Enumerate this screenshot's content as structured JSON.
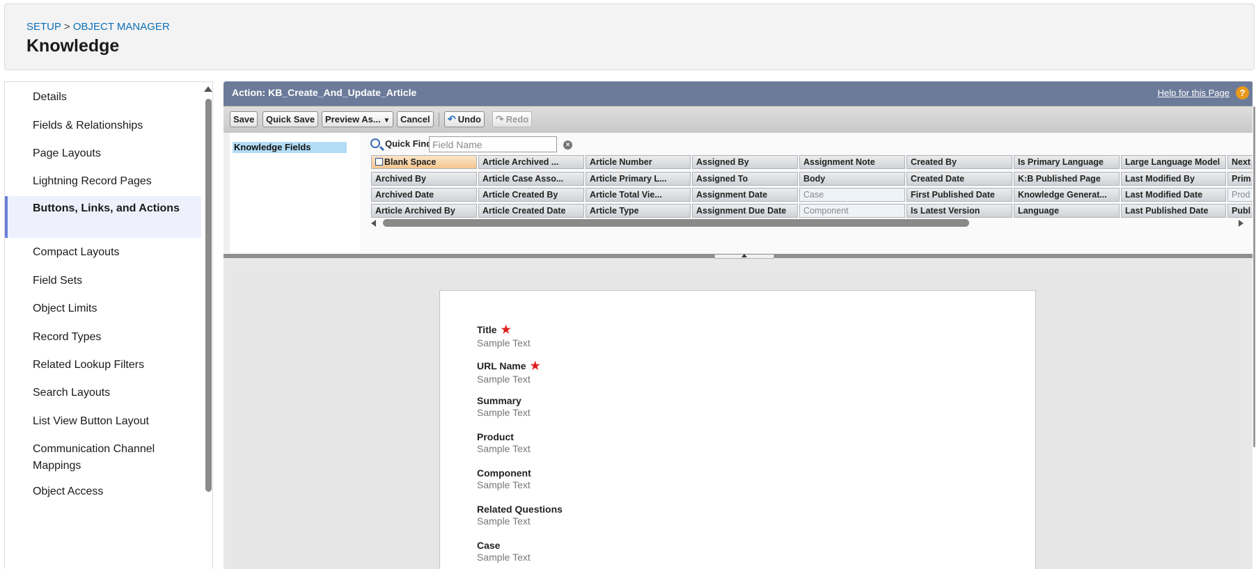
{
  "header": {
    "breadcrumb": {
      "setup": "SETUP",
      "sep": ">",
      "object_manager": "OBJECT MANAGER"
    },
    "title": "Knowledge"
  },
  "sidebar": {
    "items": [
      {
        "label": "Details"
      },
      {
        "label": "Fields & Relationships"
      },
      {
        "label": "Page Layouts"
      },
      {
        "label": "Lightning Record Pages"
      },
      {
        "label": "Buttons, Links, and Actions",
        "active": true
      },
      {
        "label": "Compact Layouts"
      },
      {
        "label": "Field Sets"
      },
      {
        "label": "Object Limits"
      },
      {
        "label": "Record Types"
      },
      {
        "label": "Related Lookup Filters"
      },
      {
        "label": "Search Layouts"
      },
      {
        "label": "List View Button Layout"
      },
      {
        "label": "Communication Channel Mappings"
      },
      {
        "label": "Object Access"
      }
    ]
  },
  "editor": {
    "title": "Action: KB_Create_And_Update_Article",
    "help_link": "Help for this Page",
    "help_icon": "?",
    "toolbar": {
      "save": "Save",
      "quick_save": "Quick Save",
      "preview_as": "Preview As...",
      "cancel": "Cancel",
      "undo": "Undo",
      "redo": "Redo"
    },
    "palette": {
      "category": "Knowledge Fields",
      "quick_find_label": "Quick Find",
      "quick_find_placeholder": "Field Name",
      "clear_icon": "×",
      "fields": [
        [
          "Blank Space",
          "Article Archived ...",
          "Article Number",
          "Assigned By",
          "Assignment Note",
          "Created By",
          "Is Primary Language",
          "Large Language Model",
          "Next"
        ],
        [
          "Archived By",
          "Article Case Asso...",
          "Article Primary L...",
          "Assigned To",
          "Body",
          "Created Date",
          "K:B Published Page",
          "Last Modified By",
          "Prim"
        ],
        [
          "Archived Date",
          "Article Created By",
          "Article Total Vie...",
          "Assignment Date",
          "Case",
          "First Published Date",
          "Knowledge Generat...",
          "Last Modified Date",
          "Prod"
        ],
        [
          "Article Archived By",
          "Article Created Date",
          "Article Type",
          "Assignment Due Date",
          "Component",
          "Is Latest Version",
          "Language",
          "Last Published Date",
          "Publ"
        ]
      ],
      "used_fields": [
        "Case",
        "Component",
        "Prod"
      ]
    },
    "form": {
      "fields": [
        {
          "label": "Title",
          "required": true,
          "value": "Sample Text"
        },
        {
          "label": "URL Name",
          "required": true,
          "value": "Sample Text"
        },
        {
          "label": "Summary",
          "required": false,
          "value": "Sample Text"
        },
        {
          "label": "Product",
          "required": false,
          "value": "Sample Text"
        },
        {
          "label": "Component",
          "required": false,
          "value": "Sample Text"
        },
        {
          "label": "Related Questions",
          "required": false,
          "value": "Sample Text"
        },
        {
          "label": "Case",
          "required": false,
          "value": "Sample Text"
        }
      ],
      "required_mark": "★"
    }
  },
  "colors": {
    "link": "#0b6fb8",
    "header_bar": "#6c7b9a",
    "active_nav_accent": "#6b7fd7",
    "required": "#e01e1e"
  }
}
